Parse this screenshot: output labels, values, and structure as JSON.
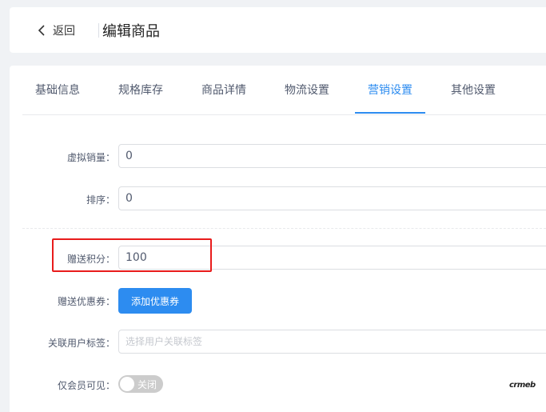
{
  "header": {
    "back_label": "返回",
    "title": "编辑商品"
  },
  "tabs": [
    {
      "label": "基础信息",
      "active": false
    },
    {
      "label": "规格库存",
      "active": false
    },
    {
      "label": "商品详情",
      "active": false
    },
    {
      "label": "物流设置",
      "active": false
    },
    {
      "label": "营销设置",
      "active": true
    },
    {
      "label": "其他设置",
      "active": false
    }
  ],
  "form": {
    "virtual_sales": {
      "label": "虚拟销量：",
      "value": "0"
    },
    "sort": {
      "label": "排序：",
      "value": "0"
    },
    "gift_points": {
      "label": "赠送积分：",
      "value": "100"
    },
    "gift_coupon": {
      "label": "赠送优惠券：",
      "button_label": "添加优惠券"
    },
    "user_tags": {
      "label": "关联用户标签：",
      "placeholder": "选择用户关联标签"
    },
    "members_only": {
      "label": "仅会员可见：",
      "switch_text": "关闭",
      "on": false
    }
  },
  "watermark": "crmeb",
  "colors": {
    "accent": "#2d8cf0",
    "highlight": "#e81c1c",
    "switch_off": "#cccccc"
  }
}
